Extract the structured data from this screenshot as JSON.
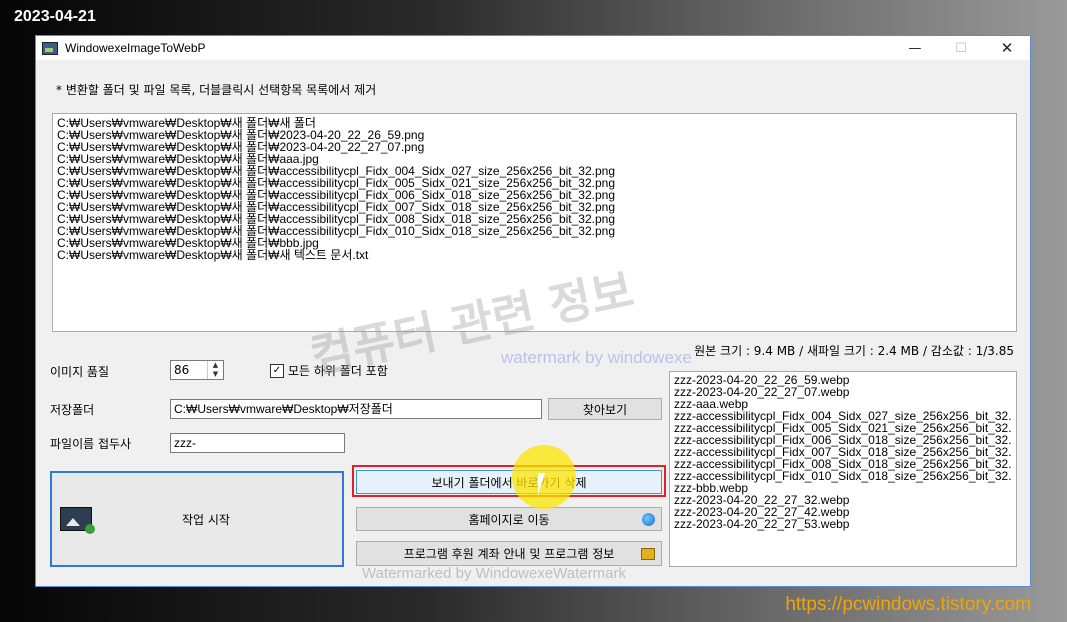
{
  "overlay": {
    "date": "2023-04-21",
    "url": "https://pcwindows.tistory.com"
  },
  "window": {
    "title": "WindowexeImageToWebP",
    "minimize": "—",
    "maximize": "☐",
    "close": "✕"
  },
  "hint": "* 변환할 폴더 및 파일 목록, 더블클릭시 선택항목 목록에서 제거",
  "input_list": [
    "C:₩Users₩vmware₩Desktop₩새 폴더₩새 폴더",
    "C:₩Users₩vmware₩Desktop₩새 폴더₩2023-04-20_22_26_59.png",
    "C:₩Users₩vmware₩Desktop₩새 폴더₩2023-04-20_22_27_07.png",
    "C:₩Users₩vmware₩Desktop₩새 폴더₩aaa.jpg",
    "C:₩Users₩vmware₩Desktop₩새 폴더₩accessibilitycpl_Fidx_004_Sidx_027_size_256x256_bit_32.png",
    "C:₩Users₩vmware₩Desktop₩새 폴더₩accessibilitycpl_Fidx_005_Sidx_021_size_256x256_bit_32.png",
    "C:₩Users₩vmware₩Desktop₩새 폴더₩accessibilitycpl_Fidx_006_Sidx_018_size_256x256_bit_32.png",
    "C:₩Users₩vmware₩Desktop₩새 폴더₩accessibilitycpl_Fidx_007_Sidx_018_size_256x256_bit_32.png",
    "C:₩Users₩vmware₩Desktop₩새 폴더₩accessibilitycpl_Fidx_008_Sidx_018_size_256x256_bit_32.png",
    "C:₩Users₩vmware₩Desktop₩새 폴더₩accessibilitycpl_Fidx_010_Sidx_018_size_256x256_bit_32.png",
    "C:₩Users₩vmware₩Desktop₩새 폴더₩bbb.jpg",
    "C:₩Users₩vmware₩Desktop₩새 폴더₩새 텍스트 문서.txt"
  ],
  "size_info": "원본 크기 : 9.4 MB / 새파일 크기 : 2.4 MB / 감소값 : 1/3.85",
  "quality": {
    "label": "이미지 품질",
    "value": "86"
  },
  "subfolders": {
    "label": "모든 하위 폴더 포함",
    "checked": true,
    "mark": "✓"
  },
  "save_folder": {
    "label": "저장폴더",
    "value": "C:₩Users₩vmware₩Desktop₩저장폴더",
    "browse": "찾아보기"
  },
  "prefix": {
    "label": "파일이름 접두사",
    "value": "zzz-"
  },
  "buttons": {
    "start": "작업 시작",
    "delete_shortcut": "보내기 폴더에서 바로가기 삭제",
    "homepage": "홈페이지로 이동",
    "donate": "프로그램 후원 계좌 안내 및 프로그램 정보"
  },
  "output_list": [
    "zzz-2023-04-20_22_26_59.webp",
    "zzz-2023-04-20_22_27_07.webp",
    "zzz-aaa.webp",
    "zzz-accessibilitycpl_Fidx_004_Sidx_027_size_256x256_bit_32.",
    "zzz-accessibilitycpl_Fidx_005_Sidx_021_size_256x256_bit_32.",
    "zzz-accessibilitycpl_Fidx_006_Sidx_018_size_256x256_bit_32.",
    "zzz-accessibilitycpl_Fidx_007_Sidx_018_size_256x256_bit_32.",
    "zzz-accessibilitycpl_Fidx_008_Sidx_018_size_256x256_bit_32.",
    "zzz-accessibilitycpl_Fidx_010_Sidx_018_size_256x256_bit_32.",
    "zzz-bbb.webp",
    "zzz-2023-04-20_22_27_32.webp",
    "zzz-2023-04-20_22_27_42.webp",
    "zzz-2023-04-20_22_27_53.webp"
  ],
  "watermarks": {
    "big": "컴퓨터 관련 정보",
    "small": "watermark by windowexe",
    "bottom": "Watermarked by WindowexeWatermark"
  }
}
